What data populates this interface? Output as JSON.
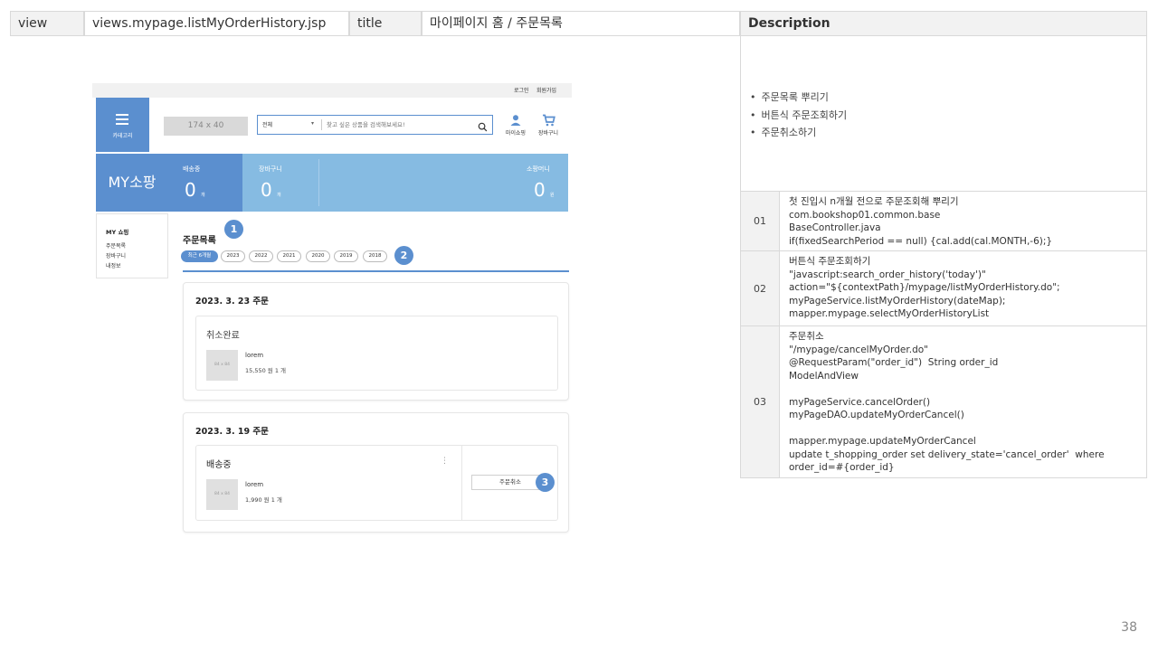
{
  "header": {
    "view_label": "view",
    "view_value": "views.mypage.listMyOrderHistory.jsp",
    "title_label": "title",
    "title_value": "마이페이지 홈 / 주문목록",
    "description_label": "Description"
  },
  "description": {
    "bullets": [
      "주문목록 뿌리기",
      "버튼식 주문조회하기",
      "주문취소하기"
    ],
    "rows": [
      {
        "num": "01",
        "text": "첫 진입시 n개월 전으로 주문조회해 뿌리기\ncom.bookshop01.common.base\nBaseController.java\nif(fixedSearchPeriod == null) {cal.add(cal.MONTH,-6);}"
      },
      {
        "num": "02",
        "text": "버튼식 주문조회하기\n\"javascript:search_order_history('today')\"\naction=\"${contextPath}/mypage/listMyOrderHistory.do\";\nmyPageService.listMyOrderHistory(dateMap);\nmapper.mypage.selectMyOrderHistoryList"
      },
      {
        "num": "03",
        "text": "주문취소\n\"/mypage/cancelMyOrder.do\"\n@RequestParam(\"order_id\")  String order_id\nModelAndView\n\nmyPageService.cancelOrder()\nmyPageDAO.updateMyOrderCancel()\n\nmapper.mypage.updateMyOrderCancel\nupdate t_shopping_order set delivery_state='cancel_order'  where\norder_id=#{order_id}"
      }
    ]
  },
  "page_number": "38",
  "mockup": {
    "topbar": {
      "login": "로그인",
      "signup": "회원가입"
    },
    "category_label": "카테고리",
    "logo_placeholder": "174 x 40",
    "search": {
      "category": "전체",
      "placeholder": "찾고 싶은 상품을 검색해보세요!"
    },
    "icons": {
      "mypage": "마이쇼핑",
      "cart": "장바구니"
    },
    "banner": {
      "title": "MY소팡",
      "shipping_label": "배송중",
      "shipping_value": "0",
      "shipping_unit": "개",
      "cart_label": "장바구니",
      "cart_value": "0",
      "cart_unit": "개",
      "money_label": "소팡머니",
      "money_value": "0",
      "money_unit": "원"
    },
    "sidebar": {
      "title": "MY 쇼핑",
      "items": [
        "주문목록",
        "장바구니",
        "내정보"
      ]
    },
    "section_title": "주문목록",
    "badges": [
      "1",
      "2",
      "3"
    ],
    "period_buttons": [
      "최근 6개월",
      "2023",
      "2022",
      "2021",
      "2020",
      "2019",
      "2018"
    ],
    "orders": [
      {
        "date": "2023. 3. 23 주문",
        "status": "취소완료",
        "thumb": "84 x 84",
        "name": "lorem",
        "price": "15,550 원  1 개"
      },
      {
        "date": "2023. 3. 19 주문",
        "status": "배송중",
        "thumb": "84 x 84",
        "name": "lorem",
        "price": "1,990 원  1 개",
        "cancel_label": "주문취소"
      }
    ]
  }
}
